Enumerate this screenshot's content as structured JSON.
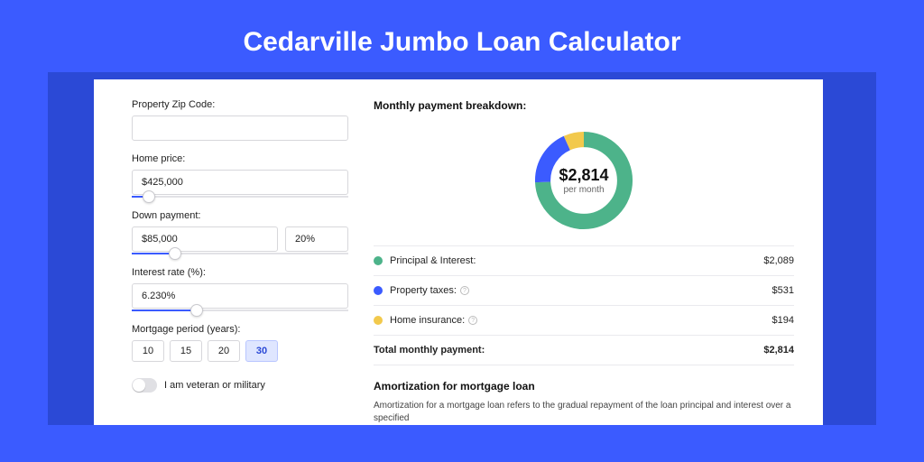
{
  "title": "Cedarville Jumbo Loan Calculator",
  "form": {
    "zip_label": "Property Zip Code:",
    "zip_value": "",
    "home_price_label": "Home price:",
    "home_price_value": "$425,000",
    "home_price_slider_pct": 8,
    "down_label": "Down payment:",
    "down_value": "$85,000",
    "down_pct": "20%",
    "down_slider_pct": 20,
    "rate_label": "Interest rate (%):",
    "rate_value": "6.230%",
    "rate_slider_pct": 30,
    "period_label": "Mortgage period (years):",
    "periods": [
      "10",
      "15",
      "20",
      "30"
    ],
    "period_active": "30",
    "veteran_label": "I am veteran or military"
  },
  "breakdown": {
    "title": "Monthly payment breakdown:",
    "center_amount": "$2,814",
    "center_sub": "per month",
    "items": [
      {
        "label": "Principal & Interest:",
        "value": "$2,089",
        "color": "#4DB38A",
        "info": false
      },
      {
        "label": "Property taxes:",
        "value": "$531",
        "color": "#3B5BFF",
        "info": true
      },
      {
        "label": "Home insurance:",
        "value": "$194",
        "color": "#F2C94C",
        "info": true
      }
    ],
    "total_label": "Total monthly payment:",
    "total_value": "$2,814"
  },
  "amort": {
    "title": "Amortization for mortgage loan",
    "text": "Amortization for a mortgage loan refers to the gradual repayment of the loan principal and interest over a specified"
  },
  "chart_data": {
    "type": "pie",
    "title": "Monthly payment breakdown",
    "series": [
      {
        "name": "Principal & Interest",
        "value": 2089,
        "color": "#4DB38A"
      },
      {
        "name": "Property taxes",
        "value": 531,
        "color": "#3B5BFF"
      },
      {
        "name": "Home insurance",
        "value": 194,
        "color": "#F2C94C"
      }
    ],
    "total": 2814
  }
}
